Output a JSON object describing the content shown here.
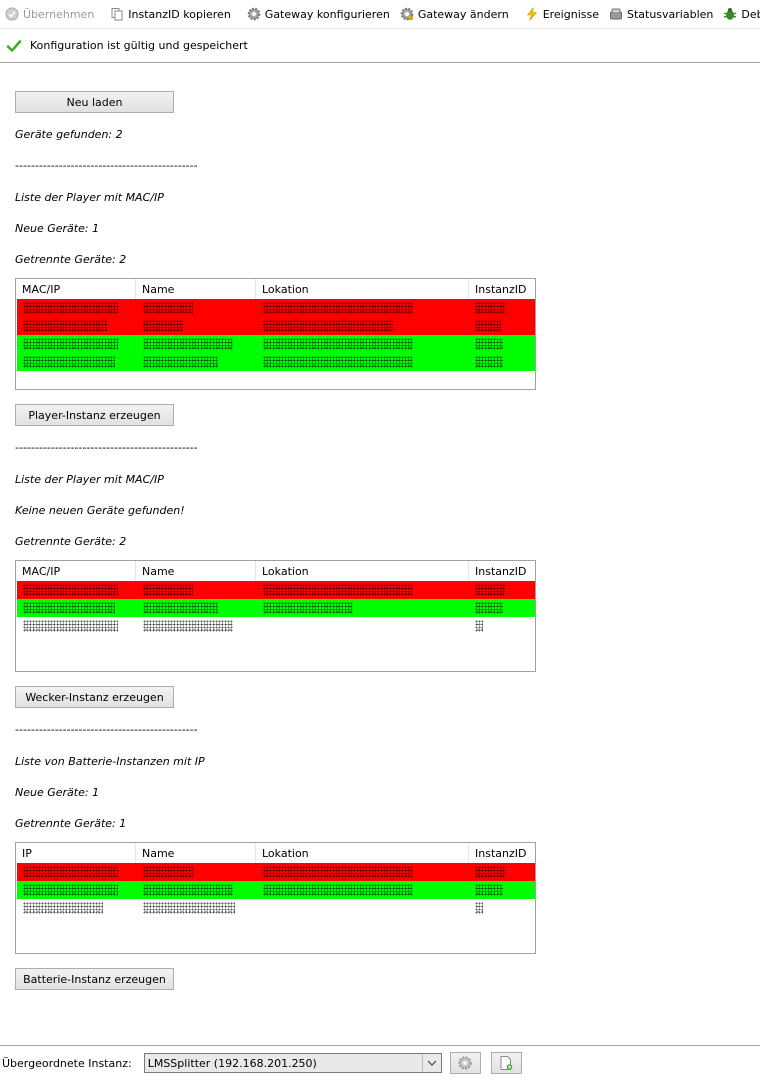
{
  "toolbar": {
    "apply_label": "Übernehmen",
    "copy_label": "InstanzID kopieren",
    "configure_gateway_label": "Gateway konfigurieren",
    "change_gateway_label": "Gateway ändern",
    "events_label": "Ereignisse",
    "statusvars_label": "Statusvariablen",
    "debug_label": "Debug"
  },
  "status": {
    "message": "Konfiguration ist gültig und gespeichert",
    "color": "#3fae29"
  },
  "main": {
    "reload_label": "Neu laden",
    "found_text": "Geräte gefunden: 2",
    "separator": "----------------------------------------------",
    "players": {
      "list_title": "Liste der Player mit MAC/IP",
      "new_text": "Neue Geräte: 1",
      "disconnected_text": "Getrennte Geräte: 2",
      "columns": [
        "MAC/IP",
        "Name",
        "Lokation",
        "InstanzID"
      ],
      "button_label": "Player-Instanz erzeugen"
    },
    "alarms": {
      "list_title": "Liste der Player mit MAC/IP",
      "new_text": "Keine neuen Geräte gefunden!",
      "disconnected_text": "Getrennte Geräte: 2",
      "columns": [
        "MAC/IP",
        "Name",
        "Lokation",
        "InstanzID"
      ],
      "button_label": "Wecker-Instanz erzeugen"
    },
    "batteries": {
      "list_title": "Liste von Batterie-Instanzen mit IP",
      "new_text": "Neue Geräte: 1",
      "disconnected_text": "Getrennte Geräte: 1",
      "columns": [
        "IP",
        "Name",
        "Lokation",
        "InstanzID"
      ],
      "button_label": "Batterie-Instanz erzeugen"
    },
    "row_colors": {
      "red": "#ff0000",
      "green": "#00ff00"
    }
  },
  "footer": {
    "parent_label": "Übergeordnete Instanz:",
    "parent_value": "LMSSplitter (192.168.201.250)"
  }
}
